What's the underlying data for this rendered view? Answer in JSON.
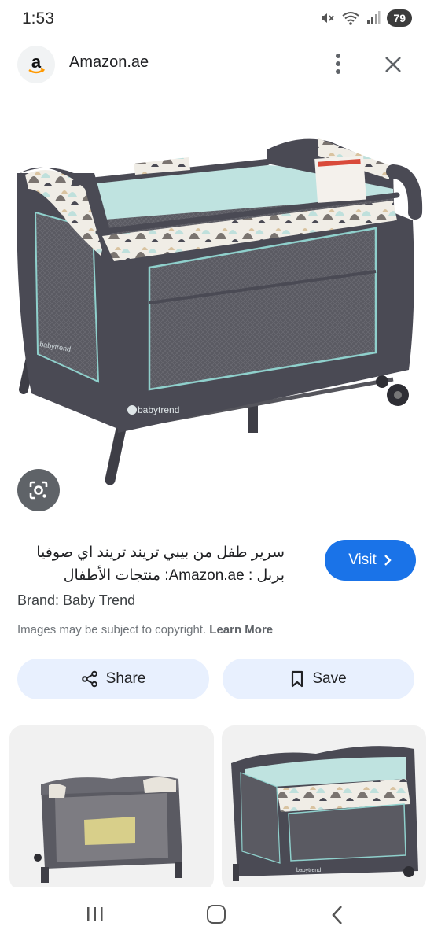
{
  "status_bar": {
    "time": "1:53",
    "battery": "79"
  },
  "header": {
    "site_name": "Amazon.ae",
    "logo_letter": "a"
  },
  "result": {
    "title_line1": "سرير طفل من بيبي تريند تريند اي صوفيا",
    "title_line2": "بربل : Amazon.ae: منتجات الأطفال",
    "visit_label": "Visit",
    "brand": "Brand: Baby Trend",
    "copyright_text": "Images may be subject to copyright.",
    "learn_more": "Learn More"
  },
  "actions": {
    "share_label": "Share",
    "save_label": "Save"
  },
  "product": {
    "brand_mark": "babytrend"
  },
  "colors": {
    "visit_bg": "#1a73e8",
    "action_bg": "#e8f0fe",
    "crib_frame": "#4a4a54",
    "crib_accent": "#8fd0cc"
  },
  "icons": [
    "mute-icon",
    "wifi-icon",
    "signal-icon",
    "more-vert-icon",
    "close-icon",
    "lens-icon",
    "chevron-right-icon",
    "share-icon",
    "bookmark-icon"
  ]
}
